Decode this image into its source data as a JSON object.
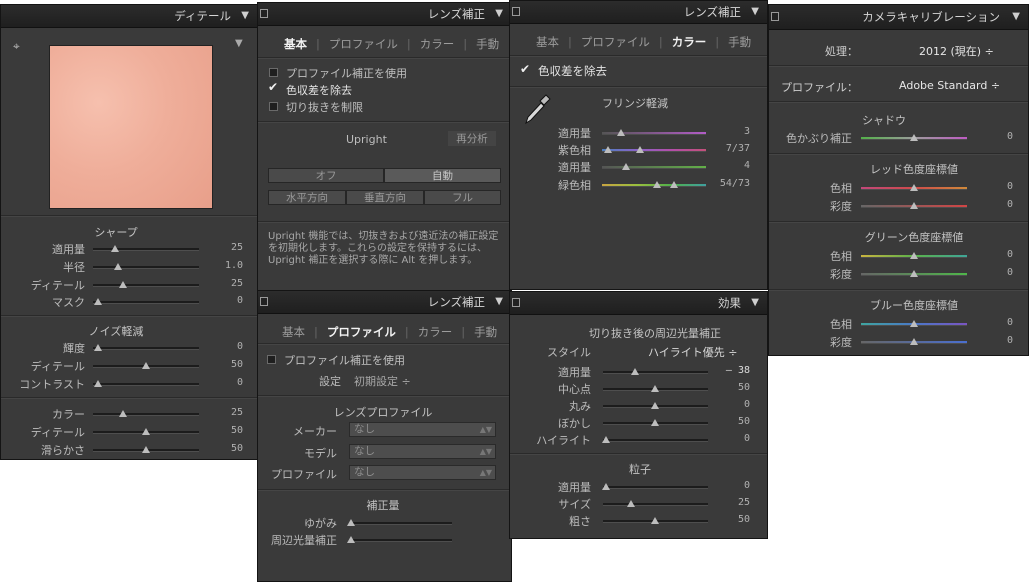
{
  "detail": {
    "title": "ディテール",
    "sharpen": {
      "heading": "シャープ",
      "rows": [
        {
          "label": "適用量",
          "value": "25"
        },
        {
          "label": "半径",
          "value": "1.0"
        },
        {
          "label": "ディテール",
          "value": "25"
        },
        {
          "label": "マスク",
          "value": "0"
        }
      ]
    },
    "noise": {
      "heading": "ノイズ軽減",
      "rows": [
        {
          "label": "輝度",
          "value": "0"
        },
        {
          "label": "ディテール",
          "value": "50"
        },
        {
          "label": "コントラスト",
          "value": "0"
        }
      ],
      "rows2": [
        {
          "label": "カラー",
          "value": "25"
        },
        {
          "label": "ディテール",
          "value": "50"
        },
        {
          "label": "滑らかさ",
          "value": "50"
        }
      ]
    }
  },
  "lens_basic": {
    "title": "レンズ補正",
    "tabs": [
      "基本",
      "プロファイル",
      "カラー",
      "手動"
    ],
    "checks": [
      "プロファイル補正を使用",
      "色収差を除去",
      "切り抜きを制限"
    ],
    "upright": "Upright",
    "reanalyze": "再分析",
    "buttons": [
      "オフ",
      "自動",
      "水平方向",
      "垂直方向",
      "フル"
    ],
    "note": "Upright 機能では、切抜きおよび遠近法の補正設定を初期化します。これらの設定を保持するには、Upright 補正を選択する際に Alt を押します。"
  },
  "lens_profile": {
    "title": "レンズ補正",
    "tabs": [
      "基本",
      "プロファイル",
      "カラー",
      "手動"
    ],
    "use_profile": "プロファイル補正を使用",
    "setting_label": "設定",
    "setting_value": "初期設定 ÷",
    "lens_profile_heading": "レンズプロファイル",
    "maker_label": "メーカー",
    "model_label": "モデル",
    "profile_label": "プロファイル",
    "none": "なし",
    "amount_heading": "補正量",
    "distortion": "ゆがみ",
    "vignetting": "周辺光量補正"
  },
  "lens_color": {
    "title": "レンズ補正",
    "tabs": [
      "基本",
      "プロファイル",
      "カラー",
      "手動"
    ],
    "remove_ca": "色収差を除去",
    "fringe_heading": "フリンジ軽減",
    "rows": [
      {
        "label": "適用量",
        "value": "3"
      },
      {
        "label": "紫色相",
        "value": "7/37"
      },
      {
        "label": "適用量",
        "value": "4"
      },
      {
        "label": "緑色相",
        "value": "54/73"
      }
    ]
  },
  "effects": {
    "title": "効果",
    "vignette_heading": "切り抜き後の周辺光量補正",
    "style_label": "スタイル",
    "style_value": "ハイライト優先 ÷",
    "rows": [
      {
        "label": "適用量",
        "value": "– 38"
      },
      {
        "label": "中心点",
        "value": "50"
      },
      {
        "label": "丸み",
        "value": "0"
      },
      {
        "label": "ぼかし",
        "value": "50"
      },
      {
        "label": "ハイライト",
        "value": "0"
      }
    ],
    "grain_heading": "粒子",
    "grain_rows": [
      {
        "label": "適用量",
        "value": "0"
      },
      {
        "label": "サイズ",
        "value": "25"
      },
      {
        "label": "粗さ",
        "value": "50"
      }
    ]
  },
  "calibration": {
    "title": "カメラキャリブレーション",
    "process_label": "処理：",
    "process_value": "2012 (現在) ÷",
    "profile_label": "プロファイル：",
    "profile_value": "Adobe Standard ÷",
    "shadow_heading": "シャドウ",
    "tint_label": "色かぶり補正",
    "tint_value": "0",
    "red_heading": "レッド色度座標値",
    "green_heading": "グリーン色度座標値",
    "blue_heading": "ブルー色度座標値",
    "hue_label": "色相",
    "sat_label": "彩度",
    "zero": "0"
  }
}
